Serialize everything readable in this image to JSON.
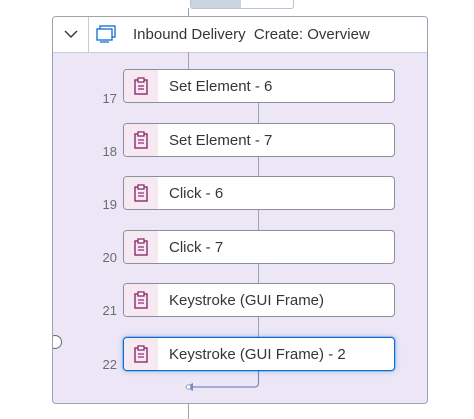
{
  "container": {
    "title": "Inbound Delivery  Create: Overview",
    "chevron_icon": "chevron-down-icon",
    "type_icon": "screen-icon"
  },
  "steps": [
    {
      "number": "17",
      "label": "Set Element - 6",
      "icon": "clipboard-icon"
    },
    {
      "number": "18",
      "label": "Set Element - 7",
      "icon": "clipboard-icon"
    },
    {
      "number": "19",
      "label": "Click - 6",
      "icon": "clipboard-icon"
    },
    {
      "number": "20",
      "label": "Click - 7",
      "icon": "clipboard-icon"
    },
    {
      "number": "21",
      "label": "Keystroke (GUI Frame)",
      "icon": "clipboard-icon"
    },
    {
      "number": "22",
      "label": "Keystroke (GUI Frame) - 2",
      "icon": "clipboard-icon",
      "selected": true
    }
  ],
  "colors": {
    "accent": "#0a6ed1",
    "container_bg": "#ece6f6",
    "step_icon_color": "#8a2b70",
    "step_icon_bg": "#f7e9f1"
  }
}
